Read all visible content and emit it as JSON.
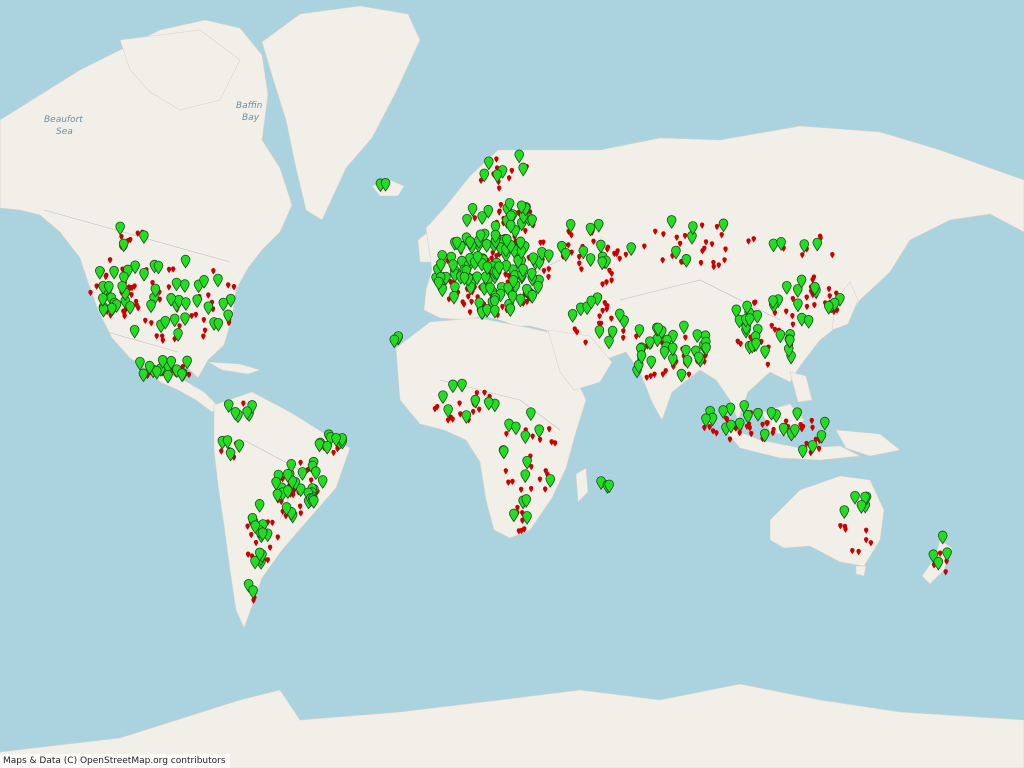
{
  "attribution": "Maps & Data (C) OpenStreetMap.org contributors",
  "map_labels": {
    "beaufort_line1": "Beaufort",
    "beaufort_line2": "Sea",
    "baffin_line1": "Baffin",
    "baffin_line2": "Bay"
  },
  "colors": {
    "ocean": "#aad3df",
    "land": "#f2efe9",
    "border": "#c9b8c8",
    "marker_green": "#22dd22",
    "marker_red": "#cc0000"
  },
  "legend_markers": {
    "green": "marker-pin-green",
    "red": "marker-dot-red"
  }
}
